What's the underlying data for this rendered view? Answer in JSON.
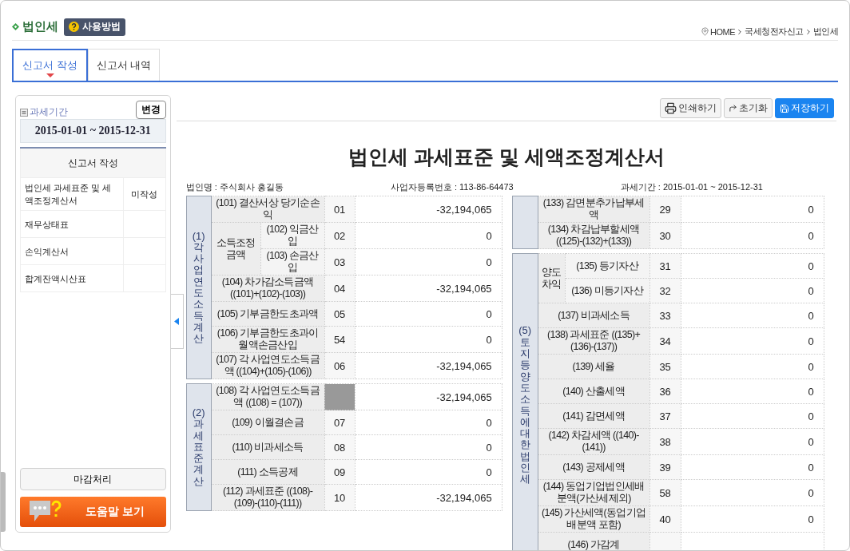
{
  "header": {
    "title": "법인세",
    "help_button": "사용방법",
    "breadcrumb": [
      "HOME",
      "국세청전자신고",
      "법인세"
    ]
  },
  "tabs": [
    {
      "label": "신고서 작성",
      "selected": true
    },
    {
      "label": "신고서 내역",
      "selected": false
    }
  ],
  "sidebar": {
    "period_label": "과세기간",
    "change_button": "변경",
    "period": "2015-01-01 ~ 2015-12-31",
    "forms_header": "신고서 작성",
    "forms": [
      {
        "name": "법인세 과세표준 및 세액조정계산서",
        "status": "미작성"
      },
      {
        "name": "재무상태표"
      },
      {
        "name": "손익계산서"
      },
      {
        "name": "합계잔액시산표"
      }
    ],
    "close_button": "마감처리",
    "help_button": "도움말 보기"
  },
  "toolbar": [
    {
      "kind": "print",
      "label": "인쇄하기"
    },
    {
      "kind": "reset",
      "label": "초기화"
    },
    {
      "kind": "save",
      "label": "저장하기"
    }
  ],
  "form": {
    "title": "법인세 과세표준 및 세액조정계산서",
    "info": [
      "법인명 : 주식회사 홍길동",
      "사업자등록번호 : 113-86-64473",
      "과세기간 : 2015-01-01 ~ 2015-12-31"
    ],
    "left_groups": [
      {
        "label": "(1) 각사업연도소득계산",
        "rows": [
          {
            "kind": "line",
            "label": "(101) 결산서상 당기순손익",
            "code": "01",
            "value": "-32,194,065"
          },
          {
            "kind": "split",
            "label": "소득조정 금액",
            "rows": [
              {
                "label": "(102) 익금산입",
                "code": "02",
                "value": "0"
              },
              {
                "label": "(103) 손금산입",
                "code": "03",
                "value": "0"
              }
            ]
          },
          {
            "kind": "line",
            "label": "(104) 차가감소득금액 ((101)+(102)-(103))",
            "code": "04",
            "value": "-32,194,065"
          },
          {
            "kind": "line",
            "label": "(105) 기부금한도초과액",
            "code": "05",
            "value": "0"
          },
          {
            "kind": "line",
            "label": "(106) 기부금한도초과이월액손금산입",
            "code": "54",
            "value": "0"
          },
          {
            "kind": "line",
            "label": "(107) 각 사업연도소득금액 ((104)+(105)-(106))",
            "code": "06",
            "value": "-32,194,065"
          }
        ]
      },
      {
        "label": "(2) 과세표준계산",
        "rows": [
          {
            "kind": "blocked",
            "label": "(108) 각 사업연도소득금액 ((108) = (107))",
            "value": "-32,194,065"
          },
          {
            "kind": "line",
            "label": "(109) 이월결손금",
            "code": "07",
            "value": "0"
          },
          {
            "kind": "line",
            "label": "(110) 비과세소득",
            "code": "08",
            "value": "0"
          },
          {
            "kind": "line",
            "label": "(111) 소득공제",
            "code": "09",
            "value": "0"
          },
          {
            "kind": "line",
            "label": "(112) 과세표준 ((108)-(109)-(110)-(111))",
            "code": "10",
            "value": "-32,194,065"
          }
        ]
      }
    ],
    "right_groups": [
      {
        "rows": [
          {
            "kind": "line",
            "label": "(133) 감면분추가납부세액",
            "code": "29",
            "value": "0"
          },
          {
            "kind": "line",
            "label": "(134) 차감납부할세액 ((125)-(132)+(133))",
            "code": "30",
            "value": "0"
          }
        ]
      },
      {
        "label": "(5) 토지등양도소득에대한법인세",
        "rows": [
          {
            "kind": "split",
            "label": "양도 차익",
            "rows": [
              {
                "label": "(135) 등기자산",
                "code": "31",
                "value": "0"
              },
              {
                "label": "(136) 미등기자산",
                "code": "32",
                "value": "0"
              }
            ]
          },
          {
            "kind": "line",
            "label": "(137) 비과세소득",
            "code": "33",
            "value": "0"
          },
          {
            "kind": "line",
            "label": "(138) 과세표준 ((135)+(136)-(137))",
            "code": "34",
            "value": "0"
          },
          {
            "kind": "line",
            "label": "(139) 세율",
            "code": "35",
            "value": "0"
          },
          {
            "kind": "line",
            "label": "(140) 산출세액",
            "code": "36",
            "value": "0"
          },
          {
            "kind": "line",
            "label": "(141) 감면세액",
            "code": "37",
            "value": "0"
          },
          {
            "kind": "line",
            "label": "(142) 차감세액 ((140)-(141))",
            "code": "38",
            "value": "0"
          },
          {
            "kind": "line",
            "label": "(143) 공제세액",
            "code": "39",
            "value": "0"
          },
          {
            "kind": "line",
            "label": "(144) 동업기업법인세배분액(가산세제외)",
            "code": "58",
            "value": "0"
          },
          {
            "kind": "line",
            "label": "(145) 가산세액(동업기업배분액 포함)",
            "code": "40",
            "value": "0"
          },
          {
            "kind": "line",
            "label": "(146) 가감계"
          }
        ]
      }
    ]
  }
}
